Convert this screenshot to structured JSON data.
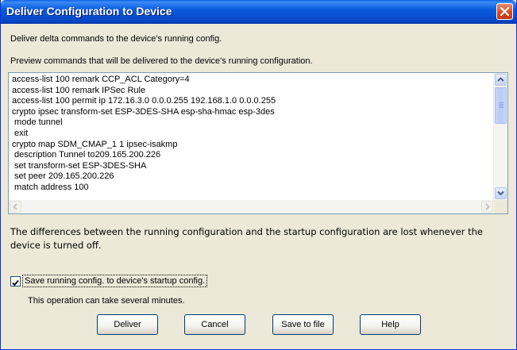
{
  "window": {
    "title": "Deliver Configuration to Device"
  },
  "intro": "Deliver delta commands to the device's running config.",
  "preview_label": "Preview commands that will be delivered to the device's running configuration.",
  "commands": [
    "access-list 100 remark CCP_ACL Category=4",
    "access-list 100 remark IPSec Rule",
    "access-list 100 permit ip 172.16.3.0 0.0.0.255 192.168.1.0 0.0.0.255",
    "crypto ipsec transform-set ESP-3DES-SHA esp-sha-hmac esp-3des",
    " mode tunnel",
    " exit",
    "crypto map SDM_CMAP_1 1 ipsec-isakmp",
    " description Tunnel to209.165.200.226",
    " set transform-set ESP-3DES-SHA",
    " set peer 209.165.200.226",
    " match address 100"
  ],
  "note": "The differences between the running configuration and the startup configuration are lost whenever the device is turned off.",
  "save_checkbox": {
    "label": "Save running config. to device's startup config.",
    "checked": true
  },
  "operation_note": "This operation can take several minutes.",
  "buttons": {
    "deliver": "Deliver",
    "cancel": "Cancel",
    "save_to_file": "Save to file",
    "help": "Help"
  },
  "icons": {
    "close": "close-icon",
    "scroll_up": "arrow-up-icon",
    "scroll_down": "arrow-down-icon",
    "scroll_left": "arrow-left-icon",
    "scroll_right": "arrow-right-icon",
    "check": "check-icon"
  },
  "colors": {
    "titlebar": "#0b5bde",
    "close": "#d4461c",
    "face": "#ece9d8",
    "button_border": "#003c74"
  }
}
